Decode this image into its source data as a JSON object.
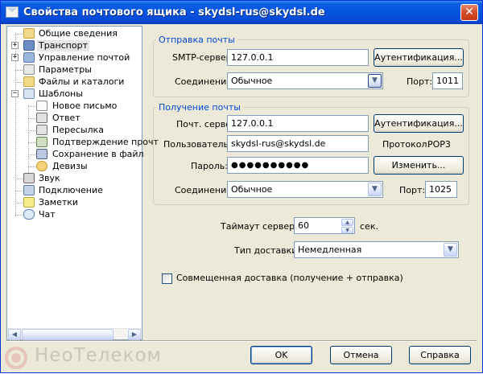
{
  "window": {
    "title": "Свойства почтового ящика - skydsl-rus@skydsl.de",
    "close_glyph": "✕"
  },
  "tree": {
    "items": [
      {
        "label": "Общие сведения",
        "icon": "folder-icon"
      },
      {
        "label": "Транспорт",
        "icon": "transport-icon",
        "expander": "+",
        "selected": true
      },
      {
        "label": "Управление почтой",
        "icon": "mail-management-icon",
        "expander": "+"
      },
      {
        "label": "Параметры",
        "icon": "settings-icon"
      },
      {
        "label": "Файлы и каталоги",
        "icon": "folder-icon"
      },
      {
        "label": "Шаблоны",
        "icon": "templates-icon",
        "expander": "−"
      },
      {
        "label": "Новое письмо",
        "icon": "new-letter-icon"
      },
      {
        "label": "Ответ",
        "icon": "reply-icon"
      },
      {
        "label": "Пересылка",
        "icon": "forward-icon"
      },
      {
        "label": "Подтверждение прочт",
        "icon": "read-receipt-icon"
      },
      {
        "label": "Сохранение в файл",
        "icon": "save-to-file-icon"
      },
      {
        "label": "Девизы",
        "icon": "mottos-icon"
      },
      {
        "label": "Звук",
        "icon": "sound-icon"
      },
      {
        "label": "Подключение",
        "icon": "connection-icon"
      },
      {
        "label": "Заметки",
        "icon": "notes-icon"
      },
      {
        "label": "Чат",
        "icon": "chat-icon"
      }
    ],
    "scroll_left": "◀",
    "scroll_right": "▶"
  },
  "outgoing": {
    "title": "Отправка почты",
    "smtp_label": "SMTP-сервер:",
    "smtp_value": "127.0.0.1",
    "auth_button": "Аутентификация...",
    "connection_label": "Соединение:",
    "connection_value": "Обычное",
    "port_label": "Порт:",
    "port_value": "1011"
  },
  "incoming": {
    "title": "Получение почты",
    "server_label": "Почт. сервер:",
    "server_value": "127.0.0.1",
    "auth_button": "Аутентификация...",
    "user_label": "Пользователь:",
    "user_value": "skydsl-rus@skydsl.de",
    "protocol_label": "Протокол:",
    "protocol_value": "POP3",
    "password_label": "Пароль:",
    "password_value": "●●●●●●●●●●",
    "change_button": "Изменить...",
    "connection_label": "Соединение:",
    "connection_value": "Обычное",
    "port_label": "Порт:",
    "port_value": "1025"
  },
  "options": {
    "timeout_label": "Таймаут сервера:",
    "timeout_value": "60",
    "timeout_unit": "сек.",
    "delivery_label": "Тип доставки:",
    "delivery_value": "Немедленная",
    "combined_label": "Совмещенная доставка (получение + отправка)",
    "combined_checked": false
  },
  "footer": {
    "watermark": "НеоТелеком",
    "ok": "OK",
    "cancel": "Отмена",
    "help": "Справка"
  },
  "glyphs": {
    "dropdown": "▼",
    "spin_up": "▲",
    "spin_down": "▼"
  }
}
